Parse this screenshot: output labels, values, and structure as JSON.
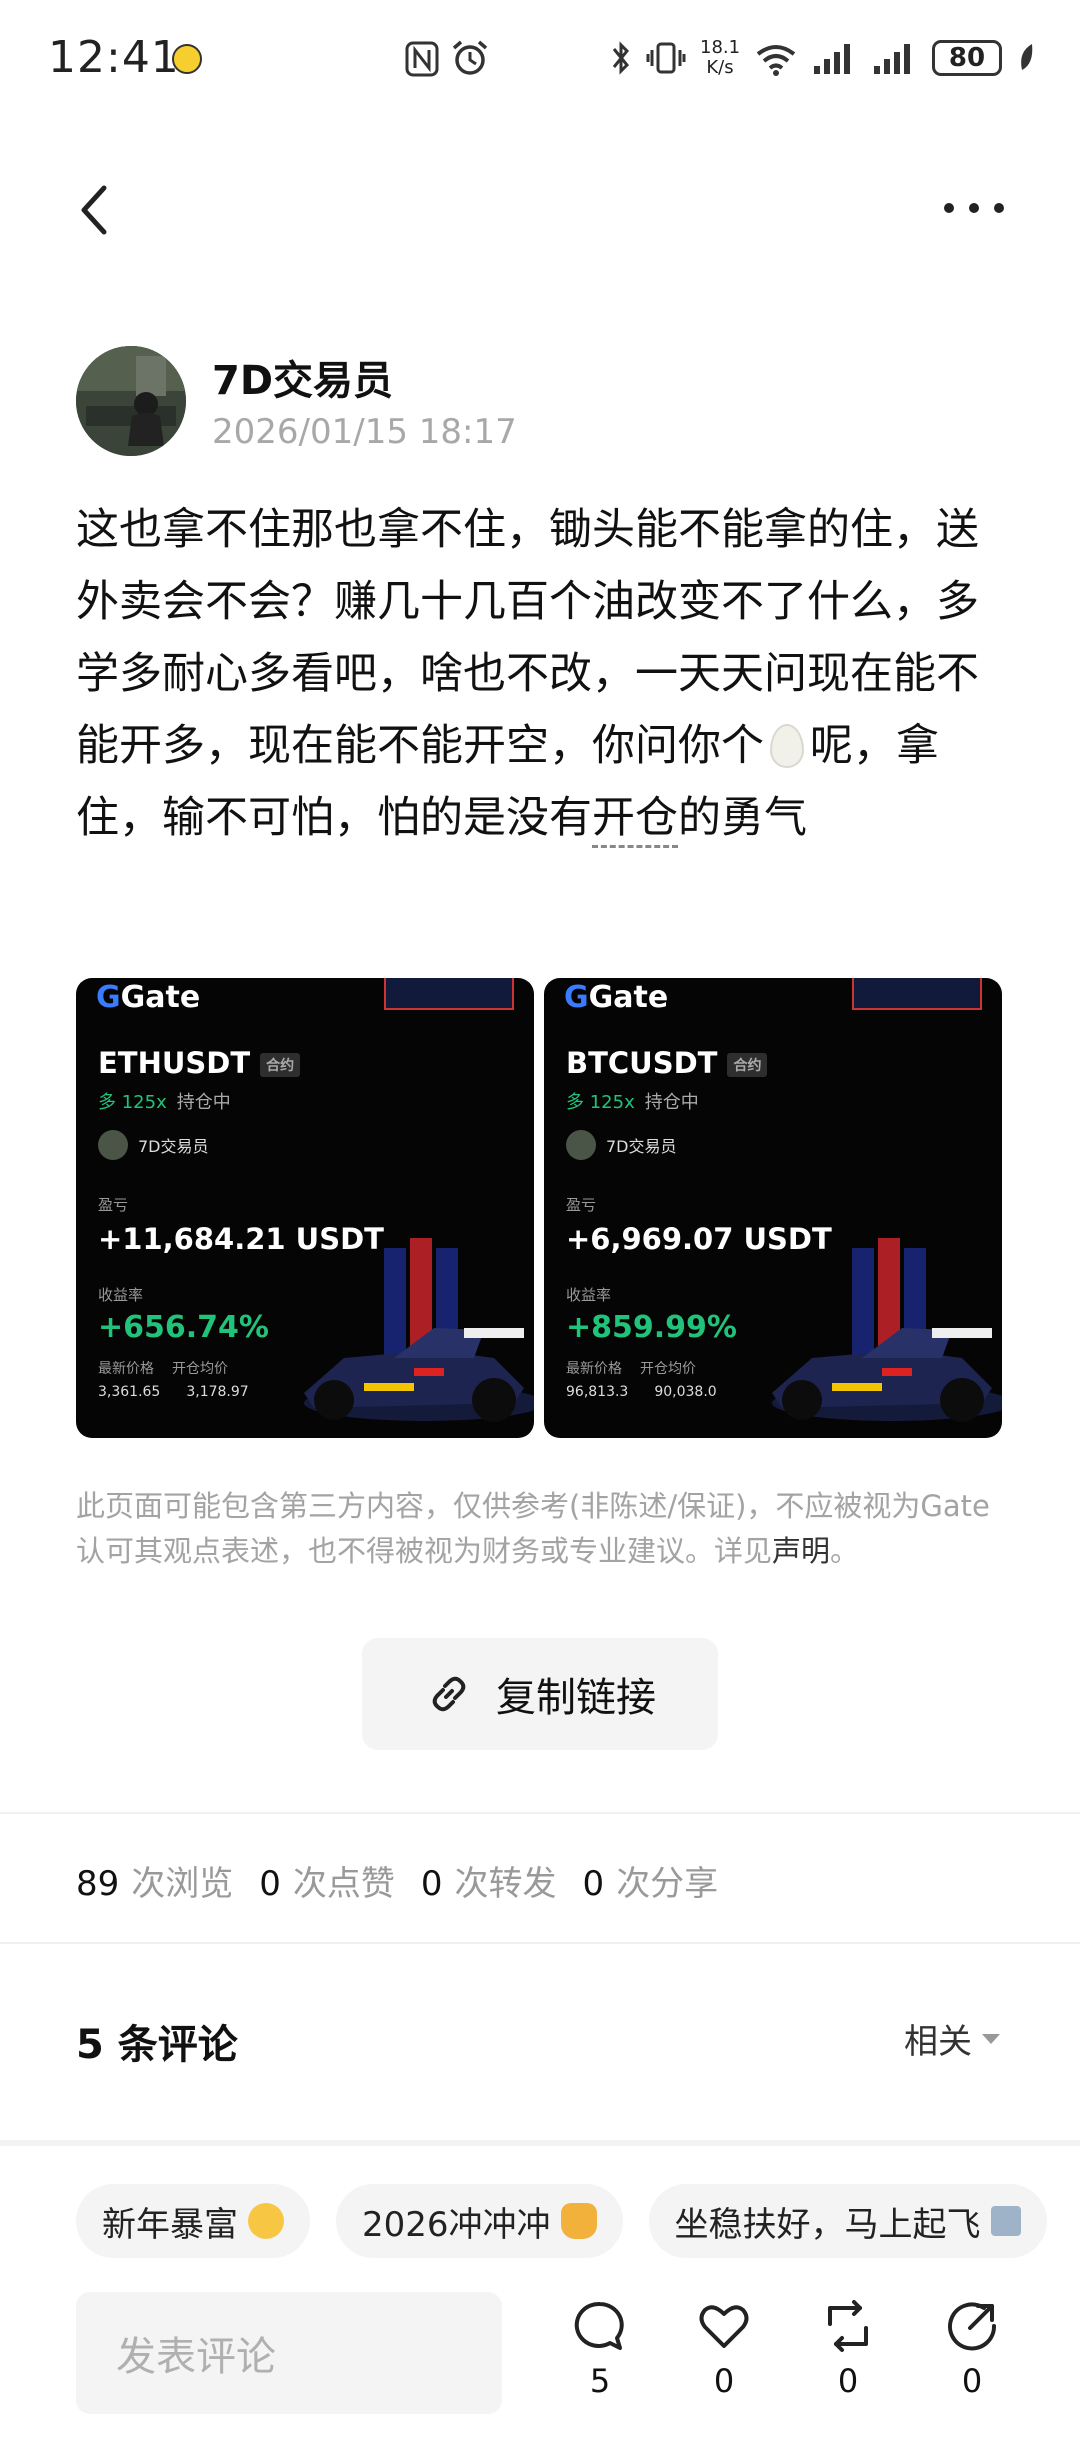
{
  "status_bar": {
    "time": "12:41",
    "net_speed_top": "18.1",
    "net_speed_bottom": "K/s",
    "battery": "80"
  },
  "author": {
    "name": "7D交易员",
    "time": "2026/01/15 18:17"
  },
  "post": {
    "text_before_egg": "这也拿不住那也拿不住，锄头能不能拿的住，送外卖会不会？赚几十几百个油改变不了什么，多学多耐心多看吧，啥也不改，一天天问现在能不能开多，现在能不能开空，你问你个",
    "text_after_egg": "呢，拿住，输不可怕，怕的是没有",
    "text_link": "开仓",
    "text_end": "的勇气"
  },
  "cards": [
    {
      "brand_prefix": "G",
      "brand": "Gate",
      "pair": "ETHUSDT",
      "contract": "合约",
      "leverage": "多 125x",
      "status": "持仓中",
      "trader": "7D交易员",
      "pnl_label": "盈亏",
      "pnl": "+11,684.21 USDT",
      "roi_label": "收益率",
      "roi": "+656.74%",
      "price_label": "最新价格",
      "avg_label": "开仓均价",
      "price": "3,361.65",
      "avg": "3,178.97"
    },
    {
      "brand_prefix": "G",
      "brand": "Gate",
      "pair": "BTCUSDT",
      "contract": "合约",
      "leverage": "多 125x",
      "status": "持仓中",
      "trader": "7D交易员",
      "pnl_label": "盈亏",
      "pnl": "+6,969.07 USDT",
      "roi_label": "收益率",
      "roi": "+859.99%",
      "price_label": "最新价格",
      "avg_label": "开仓均价",
      "price": "96,813.3",
      "avg": "90,038.0"
    }
  ],
  "disclaimer": {
    "text": "此页面可能包含第三方内容，仅供参考(非陈述/保证)，不应被视为Gate认可其观点表述，也不得被视为财务或专业建议。详见",
    "link": "声明",
    "end": "。"
  },
  "copy_link": "复制链接",
  "stats": {
    "views": "89",
    "views_label": "次浏览",
    "likes": "0",
    "likes_label": "次点赞",
    "reposts": "0",
    "reposts_label": "次转发",
    "shares": "0",
    "shares_label": "次分享"
  },
  "comments": {
    "title": "5 条评论",
    "sort": "相关"
  },
  "quick_tags": [
    {
      "label": "新年暴富",
      "icon": "money-face-emoji-icon"
    },
    {
      "label": "2026冲冲冲",
      "icon": "fist-bump-emoji-icon"
    },
    {
      "label": "坐稳扶好，马上起飞",
      "icon": "airplane-emoji-icon"
    }
  ],
  "bottom_bar": {
    "placeholder": "发表评论",
    "comment_count": "5",
    "like_count": "0",
    "repost_count": "0",
    "share_count": "0"
  },
  "colors": {
    "green": "#21c37b",
    "gate_blue": "#3a7cff",
    "muted": "#a3a3a3"
  }
}
